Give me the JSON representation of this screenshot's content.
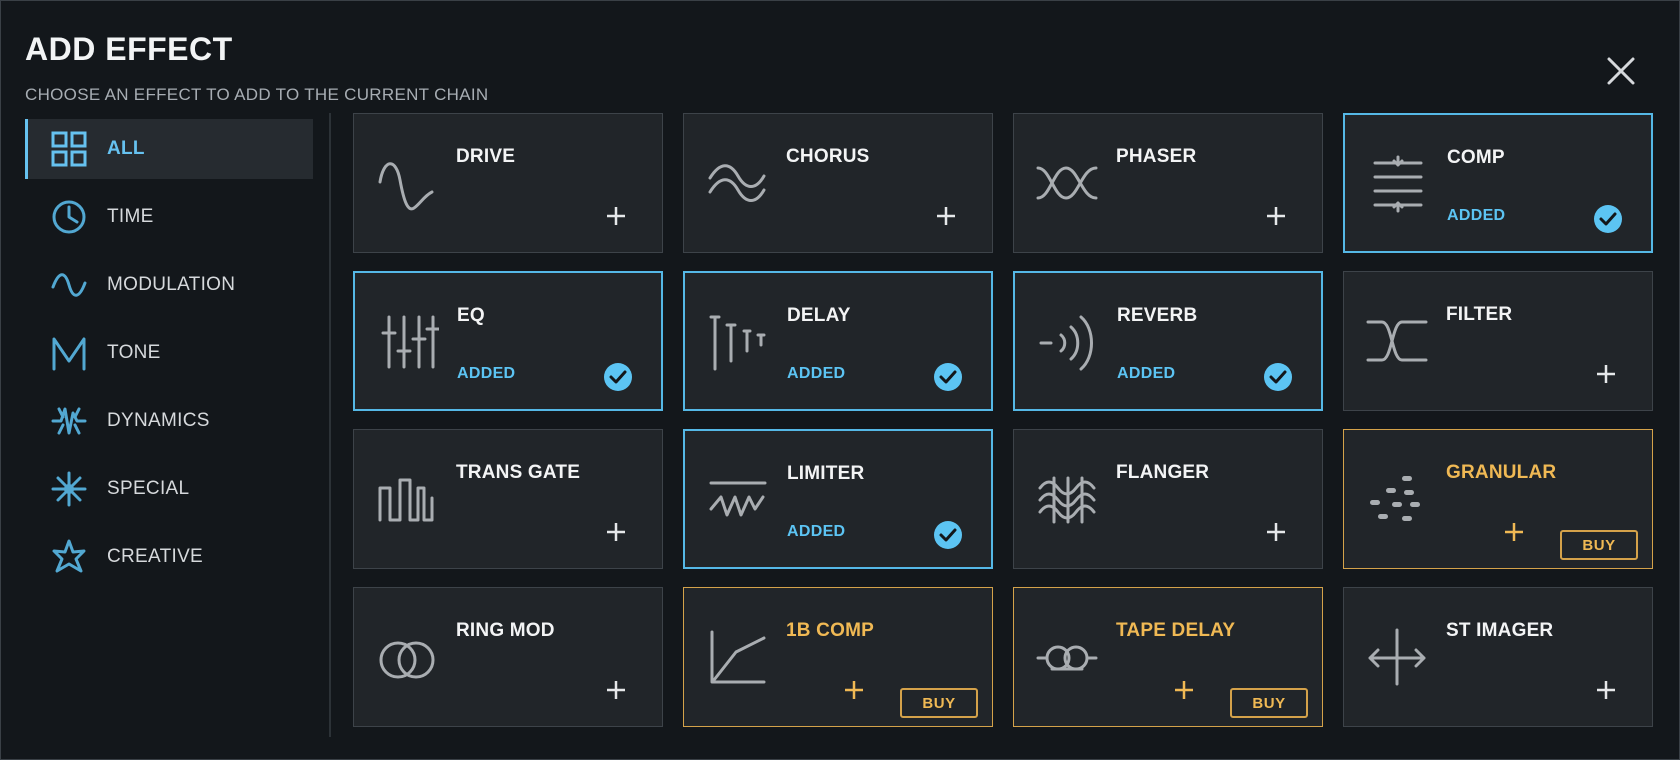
{
  "dialog": {
    "title": "ADD EFFECT",
    "subtitle": "CHOOSE AN EFFECT TO ADD TO THE CURRENT CHAIN",
    "close_icon": "close-icon"
  },
  "colors": {
    "accent": "#66c2f0",
    "added_border": "#55b8e6",
    "premium": "#f0b954",
    "card_bg": "#212529",
    "background": "#13171b"
  },
  "categories": [
    {
      "label": "ALL",
      "icon": "grid-icon",
      "active": true
    },
    {
      "label": "TIME",
      "icon": "clock-icon",
      "active": false
    },
    {
      "label": "MODULATION",
      "icon": "wave-icon",
      "active": false
    },
    {
      "label": "TONE",
      "icon": "tone-curve-icon",
      "active": false
    },
    {
      "label": "DYNAMICS",
      "icon": "dynamics-icon",
      "active": false
    },
    {
      "label": "SPECIAL",
      "icon": "sparkle-icon",
      "active": false
    },
    {
      "label": "CREATIVE",
      "icon": "star-icon",
      "active": false
    }
  ],
  "effects": [
    {
      "name": "DRIVE",
      "icon": "sine-icon",
      "state": "available"
    },
    {
      "name": "CHORUS",
      "icon": "chorus-icon",
      "state": "available"
    },
    {
      "name": "PHASER",
      "icon": "phaser-icon",
      "state": "available"
    },
    {
      "name": "COMP",
      "icon": "compressor-icon",
      "state": "added",
      "status": "ADDED"
    },
    {
      "name": "EQ",
      "icon": "equalizer-icon",
      "state": "added",
      "status": "ADDED"
    },
    {
      "name": "DELAY",
      "icon": "delay-icon",
      "state": "added",
      "status": "ADDED"
    },
    {
      "name": "REVERB",
      "icon": "reverb-icon",
      "state": "added",
      "status": "ADDED"
    },
    {
      "name": "FILTER",
      "icon": "filter-icon",
      "state": "available"
    },
    {
      "name": "TRANS GATE",
      "icon": "gate-icon",
      "state": "available"
    },
    {
      "name": "LIMITER",
      "icon": "limiter-icon",
      "state": "added",
      "status": "ADDED"
    },
    {
      "name": "FLANGER",
      "icon": "flanger-icon",
      "state": "available"
    },
    {
      "name": "GRANULAR",
      "icon": "granular-icon",
      "state": "premium",
      "buy_label": "BUY"
    },
    {
      "name": "RING MOD",
      "icon": "ring-mod-icon",
      "state": "available"
    },
    {
      "name": "1B COMP",
      "icon": "comp-curve-icon",
      "state": "premium",
      "buy_label": "BUY"
    },
    {
      "name": "TAPE DELAY",
      "icon": "tape-icon",
      "state": "premium",
      "buy_label": "BUY"
    },
    {
      "name": "ST IMAGER",
      "icon": "stereo-imager-icon",
      "state": "available"
    }
  ]
}
